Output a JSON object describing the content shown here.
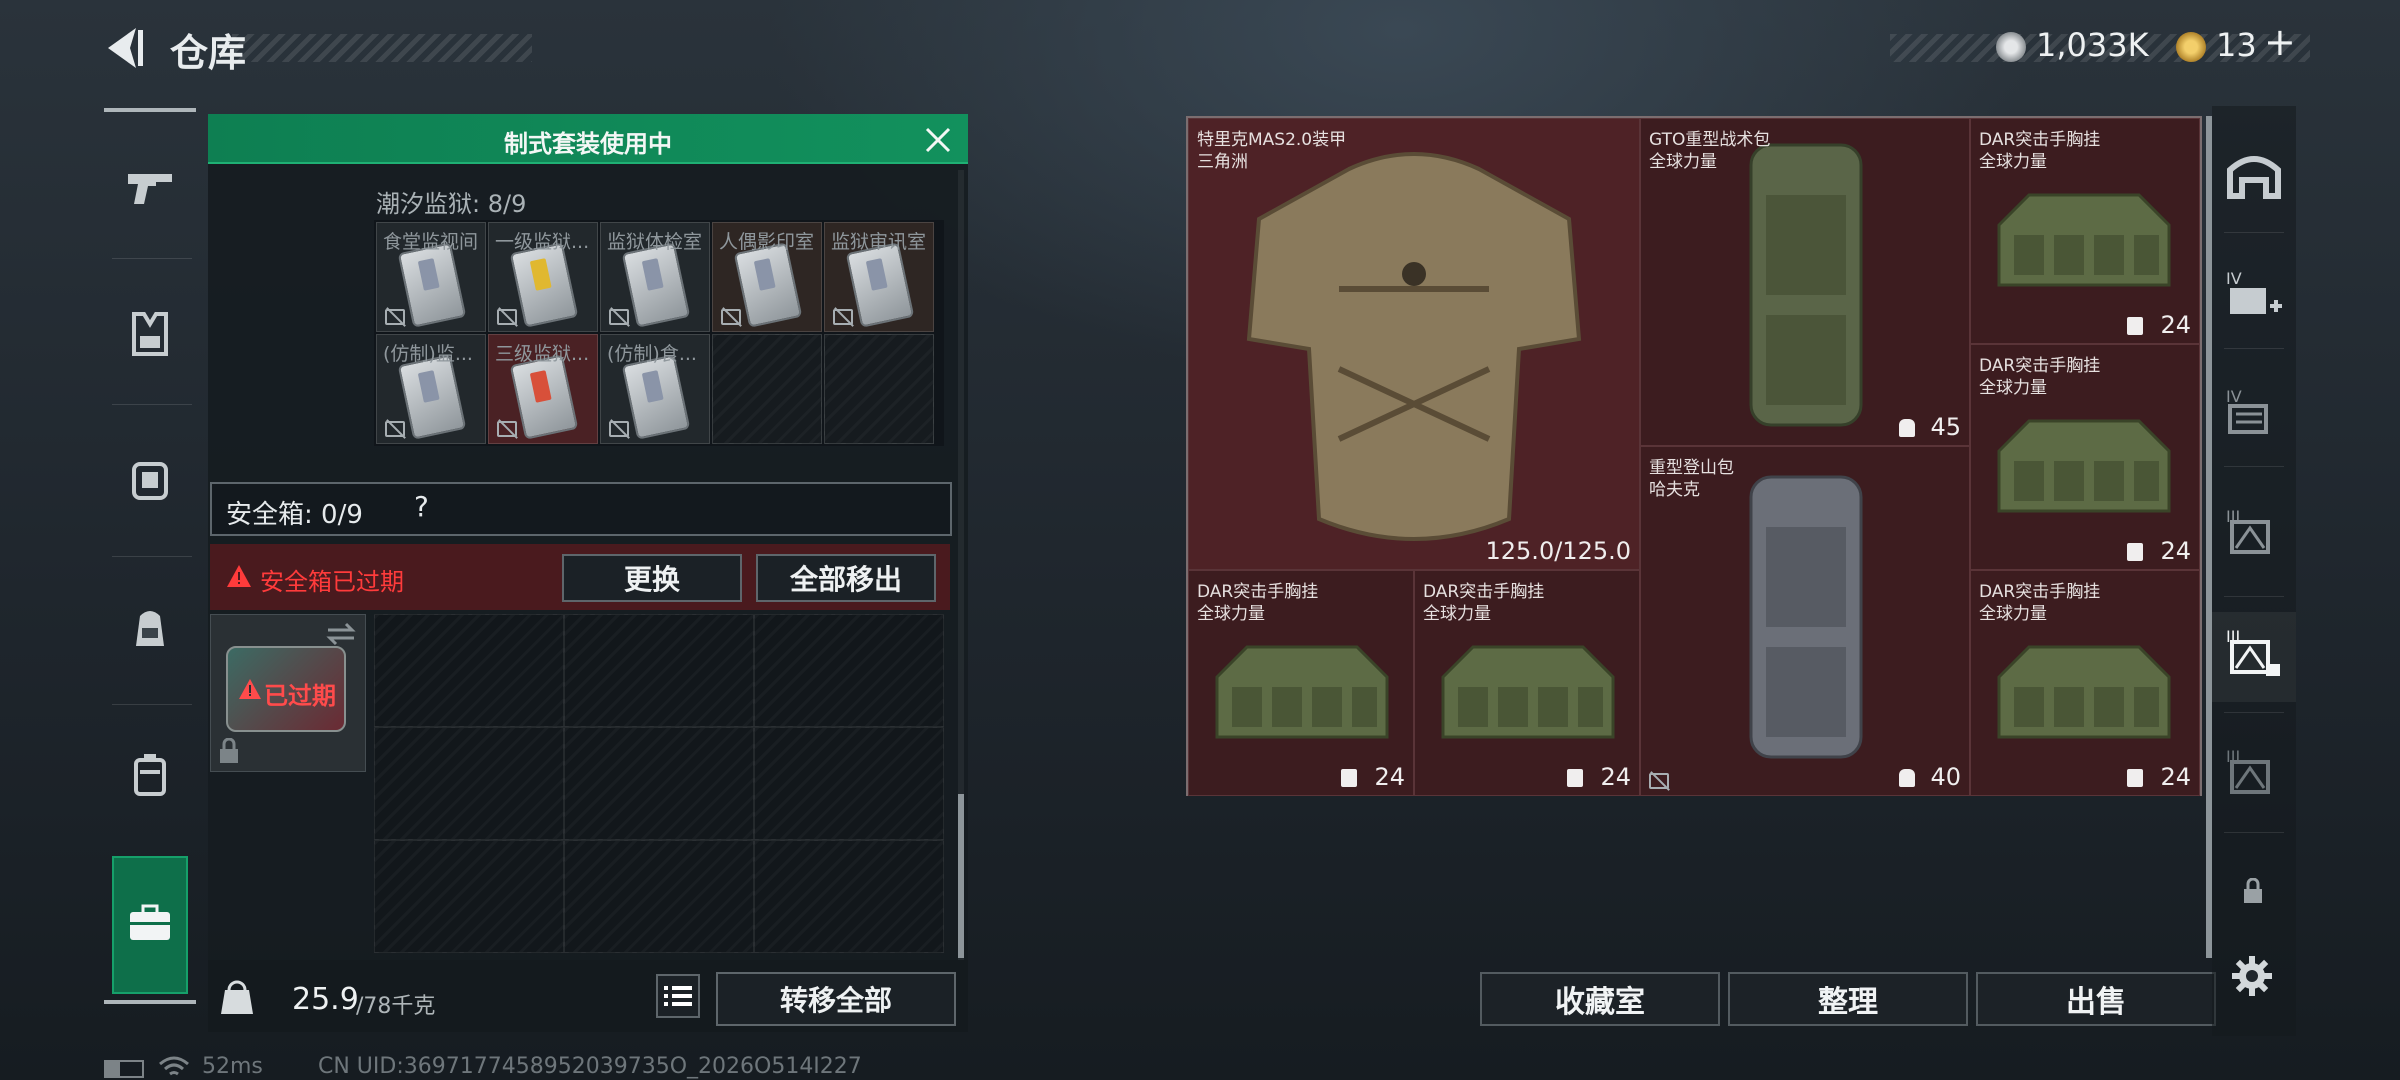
{
  "header": {
    "title": "仓库",
    "currency1": "1,033K",
    "currency2": "13",
    "plus": "+"
  },
  "left_panel": {
    "kit_banner": "制式套装使用中",
    "section_label": "潮汐监狱: 8/9",
    "key_slots": [
      {
        "name": "食堂监视间",
        "color": "gray"
      },
      {
        "name": "一级监狱...",
        "color": "yellow"
      },
      {
        "name": "监狱体检室",
        "color": "gray"
      },
      {
        "name": "人偶影印室",
        "color": "gray"
      },
      {
        "name": "监狱审讯室",
        "color": "gray"
      },
      {
        "name": "(仿制)监...",
        "color": "gray"
      },
      {
        "name": "三级监狱...",
        "color": "red"
      },
      {
        "name": "(仿制)食...",
        "color": "gray"
      }
    ],
    "safebox_label": "安全箱: 0/9",
    "help": "?",
    "expired_warning": "安全箱已过期",
    "replace_button": "更换",
    "move_all_out_button": "全部移出",
    "expired_badge": "已过期",
    "weight_value": "25.9",
    "weight_max": "/78千克",
    "transfer_all_button": "转移全部"
  },
  "items": [
    {
      "name1": "特里克MAS2.0装甲",
      "name2": "三角洲",
      "cap": "125.0/125.0"
    },
    {
      "name1": "GTO重型战术包",
      "name2": "全球力量",
      "cap": "45"
    },
    {
      "name1": "DAR突击手胸挂",
      "name2": "全球力量",
      "cap": "24"
    },
    {
      "name1": "DAR突击手胸挂",
      "name2": "全球力量",
      "cap": "24"
    },
    {
      "name1": "重型登山包",
      "name2": "哈夫克",
      "cap": "40"
    },
    {
      "name1": "DAR突击手胸挂",
      "name2": "全球力量",
      "cap": "24"
    },
    {
      "name1": "DAR突击手胸挂",
      "name2": "全球力量",
      "cap": "24"
    },
    {
      "name1": "DAR突击手胸挂",
      "name2": "全球力量",
      "cap": "24"
    }
  ],
  "right_buttons": {
    "collection": "收藏室",
    "organize": "整理",
    "sell": "出售"
  },
  "status": {
    "ping": "52ms",
    "uid": "CN UID:3697177458952039735O_2026O514I227"
  },
  "colors": {
    "accent_green": "#12915d",
    "item_bg": "#4e2226",
    "warning_red": "#e0353a"
  }
}
